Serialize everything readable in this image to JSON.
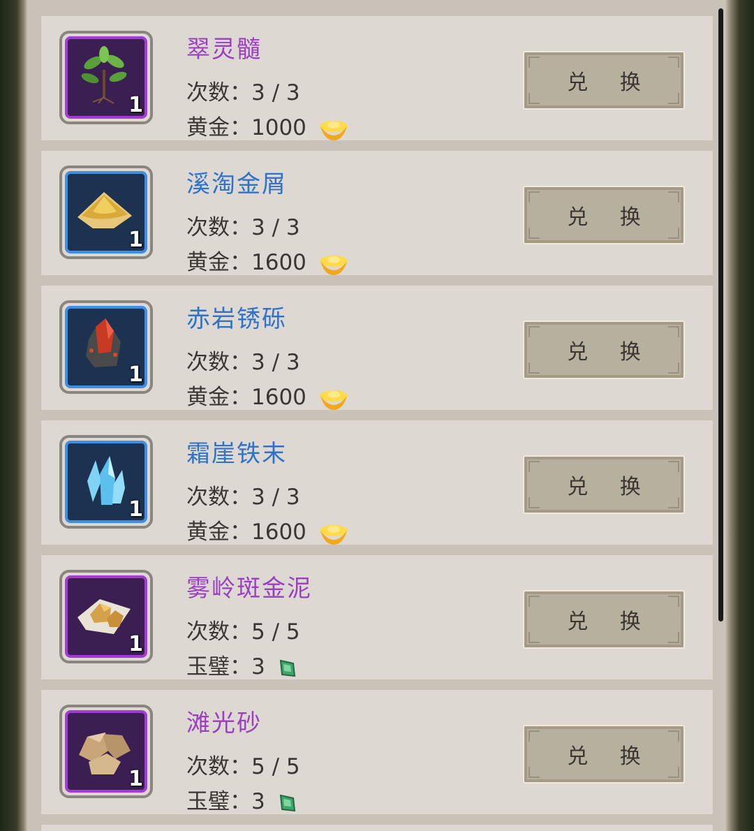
{
  "labels": {
    "count_prefix": "次数：",
    "exchange_button": "兑 换"
  },
  "items": [
    {
      "name": "翠灵髓",
      "rarity": "purple",
      "icon": "herb-icon",
      "qty": "1",
      "count": "3 / 3",
      "cost_label": "黄金：",
      "cost_value": "1000",
      "currency": "gold-ingot-icon"
    },
    {
      "name": "溪淘金屑",
      "rarity": "blue",
      "icon": "gold-dust-icon",
      "qty": "1",
      "count": "3 / 3",
      "cost_label": "黄金：",
      "cost_value": "1600",
      "currency": "gold-ingot-icon"
    },
    {
      "name": "赤岩锈砾",
      "rarity": "blue",
      "icon": "red-ore-icon",
      "qty": "1",
      "count": "3 / 3",
      "cost_label": "黄金：",
      "cost_value": "1600",
      "currency": "gold-ingot-icon"
    },
    {
      "name": "霜崖铁末",
      "rarity": "blue",
      "icon": "ice-crystal-icon",
      "qty": "1",
      "count": "3 / 3",
      "cost_label": "黄金：",
      "cost_value": "1600",
      "currency": "gold-ingot-icon"
    },
    {
      "name": "雾岭斑金泥",
      "rarity": "purple",
      "icon": "gold-nugget-icon",
      "qty": "1",
      "count": "5 / 5",
      "cost_label": "玉璧：",
      "cost_value": "3",
      "currency": "jade-icon"
    },
    {
      "name": "滩光砂",
      "rarity": "purple",
      "icon": "sandstone-icon",
      "qty": "1",
      "count": "5 / 5",
      "cost_label": "玉璧：",
      "cost_value": "3",
      "currency": "jade-icon"
    }
  ],
  "colors": {
    "purple_name": "#9a3fc0",
    "blue_name": "#2f72c8",
    "card_bg": "#ddd8d2",
    "button_bg": "#b8b09f"
  }
}
